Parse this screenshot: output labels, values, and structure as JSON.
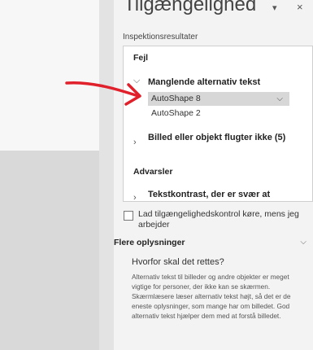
{
  "panel": {
    "title": "Tilgængelighed",
    "pin_icon": "dropdown-caret-icon",
    "close_icon": "close-icon",
    "inspection_label": "Inspektionsresultater"
  },
  "results": {
    "errors_header": "Fejl",
    "missing_alt": {
      "label": "Manglende alternativ tekst",
      "items": [
        "AutoShape 8",
        "AutoShape 2"
      ]
    },
    "floating_image_label": "Billed eller objekt flugter ikke (5)",
    "warnings_header": "Advarsler",
    "contrast_label": "Tekstkontrast, der er svær at"
  },
  "checkbox": {
    "label": "Lad tilgængelighedskontrol køre, mens jeg arbejder"
  },
  "more_info": {
    "header": "Flere oplysninger",
    "why_title": "Hvorfor skal det rettes?",
    "why_body": "Alternativ tekst til billeder og andre objekter er meget vigtige for personer, der ikke kan se skærmen. Skærmlæsere læser alternativ tekst højt, så det er de eneste oplysninger, som mange har om billedet. God alternativ tekst hjælper dem med at forstå billedet."
  },
  "colors": {
    "annotation_arrow": "#e0202a"
  }
}
